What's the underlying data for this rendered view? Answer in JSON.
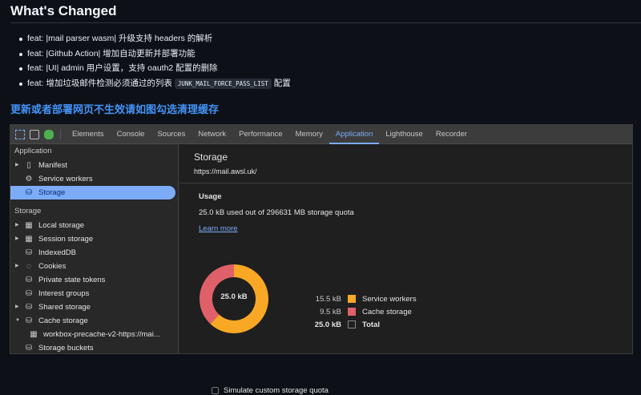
{
  "heading": "What's Changed",
  "changes": [
    "feat: |mail parser wasm| 升级支持 headers 的解析",
    "feat: |Github Action| 增加自动更新并部署功能",
    "feat: |UI| admin 用户设置，支持 oauth2 配置的删除"
  ],
  "change4": {
    "prefix": "feat: 增加垃圾邮件检测必须通过的列表",
    "code": "JUNK_MAIL_FORCE_PASS_LIST",
    "suffix": "配置"
  },
  "notice": "更新或者部署网页不生效请如图勾选清理缓存",
  "devtools": {
    "tabs": [
      "Elements",
      "Console",
      "Sources",
      "Network",
      "Performance",
      "Memory",
      "Application",
      "Lighthouse",
      "Recorder"
    ],
    "active_tab": "Application",
    "sidebar": {
      "app_section": "Application",
      "app_items": [
        {
          "label": "Manifest",
          "icon": "file-icon",
          "arrow": true
        },
        {
          "label": "Service workers",
          "icon": "gears-icon"
        },
        {
          "label": "Storage",
          "icon": "database-icon",
          "selected": true
        }
      ],
      "storage_section": "Storage",
      "storage_items": [
        {
          "label": "Local storage",
          "icon": "table-icon",
          "arrow": "right"
        },
        {
          "label": "Session storage",
          "icon": "table-icon",
          "arrow": "right"
        },
        {
          "label": "IndexedDB",
          "icon": "database-icon"
        },
        {
          "label": "Cookies",
          "icon": "cookie-icon",
          "arrow": "right"
        },
        {
          "label": "Private state tokens",
          "icon": "database-icon"
        },
        {
          "label": "Interest groups",
          "icon": "database-icon"
        },
        {
          "label": "Shared storage",
          "icon": "database-icon",
          "arrow": "right"
        },
        {
          "label": "Cache storage",
          "icon": "database-icon",
          "arrow": "down"
        },
        {
          "label": "workbox-precache-v2-https://mai...",
          "icon": "table-icon",
          "sub": true
        },
        {
          "label": "Storage buckets",
          "icon": "database-icon"
        }
      ]
    },
    "main": {
      "title": "Storage",
      "url": "https://mail.awsl.uk/",
      "usage_title": "Usage",
      "usage_text": "25.0 kB used out of 296631 MB storage quota",
      "learn_more": "Learn more",
      "center_label": "25.0 kB",
      "simulate_label": "Simulate custom storage quota"
    }
  },
  "chart_data": {
    "type": "pie",
    "donut": true,
    "series": [
      {
        "name": "Service workers",
        "value": 15.5,
        "label": "15.5 kB",
        "color": "#f9a825"
      },
      {
        "name": "Cache storage",
        "value": 9.5,
        "label": "9.5 kB",
        "color": "#e0606a"
      }
    ],
    "total": {
      "name": "Total",
      "label": "25.0 kB"
    },
    "unit": "kB"
  }
}
